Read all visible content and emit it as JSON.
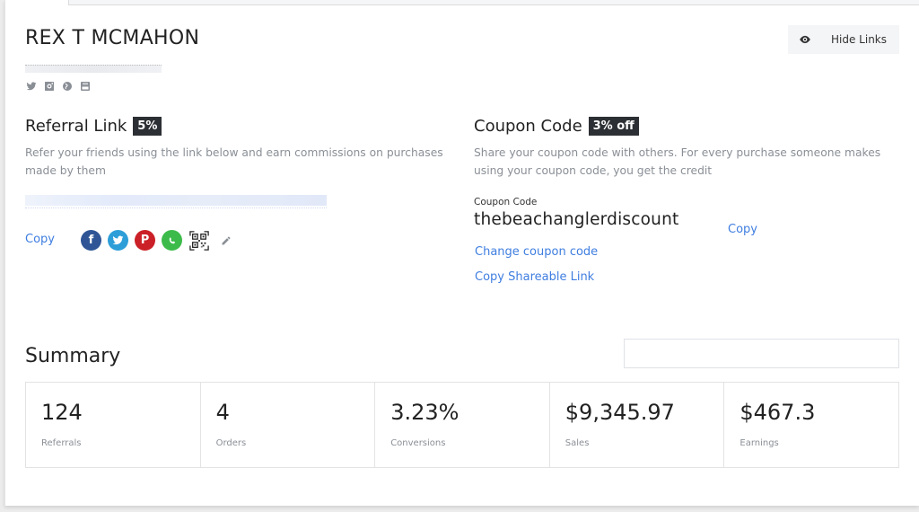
{
  "profile": {
    "name": "REX T MCMAHON",
    "email_redacted": true,
    "social_icons": [
      "twitter-icon",
      "instagram-icon",
      "globe-icon",
      "youtube-icon"
    ]
  },
  "header": {
    "hide_links_label": "Hide Links",
    "hide_links_icon": "eye-icon"
  },
  "referral": {
    "title": "Referral Link",
    "badge": "5%",
    "description": "Refer your friends using the link below and earn commissions on purchases made by them",
    "link_redacted": true,
    "copy_label": "Copy",
    "share_icons": [
      "facebook-icon",
      "twitter-icon",
      "pinterest-icon",
      "whatsapp-icon",
      "qr-code-icon",
      "pencil-icon"
    ]
  },
  "coupon": {
    "title": "Coupon Code",
    "badge": "3% off",
    "description": "Share your coupon code with others. For every purchase someone makes using your coupon code, you get the credit",
    "code_label": "Coupon Code",
    "code": "thebeachanglerdiscount",
    "copy_label": "Copy",
    "change_label": "Change coupon code",
    "share_link_label": "Copy Shareable Link"
  },
  "summary": {
    "title": "Summary",
    "date_filter_value": "",
    "stats": [
      {
        "value": "124",
        "label": "Referrals"
      },
      {
        "value": "4",
        "label": "Orders"
      },
      {
        "value": "3.23%",
        "label": "Conversions"
      },
      {
        "value": "$9,345.97",
        "label": "Sales"
      },
      {
        "value": "$467.3",
        "label": "Earnings"
      }
    ]
  },
  "colors": {
    "link": "#3f7ee0",
    "badge_bg": "#2c2f33",
    "facebook": "#2f5596",
    "twitter": "#2d9ed8",
    "pinterest": "#cb2027",
    "whatsapp": "#3dbb4a"
  }
}
